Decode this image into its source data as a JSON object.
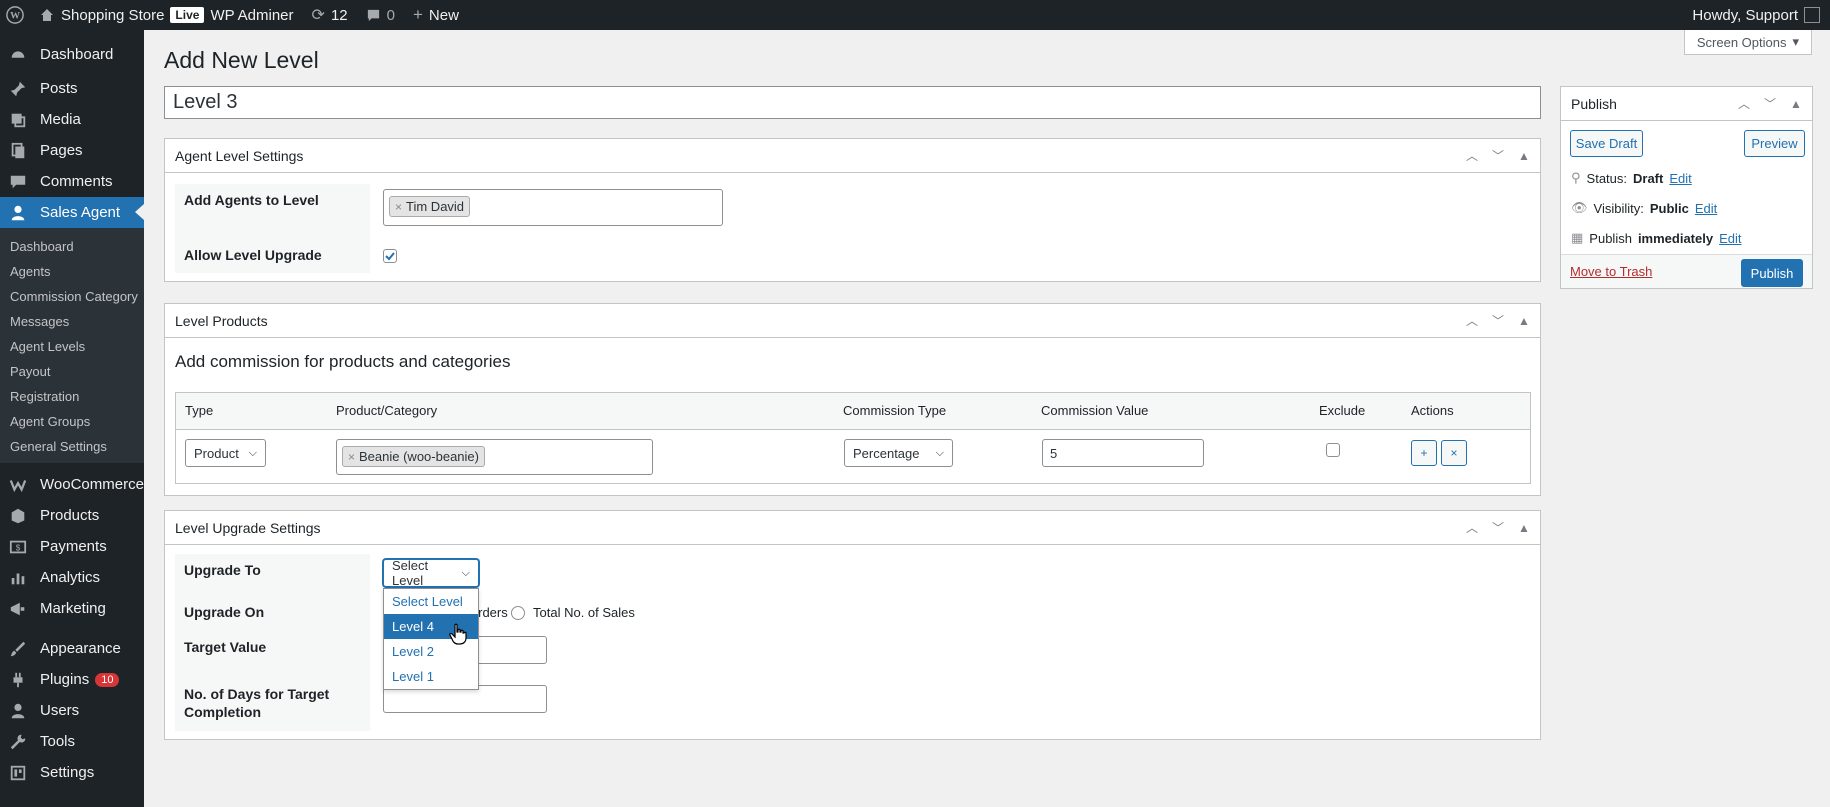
{
  "adminbar": {
    "site_name": "Shopping Store",
    "live_label": "Live",
    "admin_label": "WP Adminer",
    "updates_count": "12",
    "comments_count": "0",
    "new_label": "New",
    "howdy": "Howdy, Support"
  },
  "sidebar": {
    "items_top": [
      {
        "label": "Dashboard",
        "icon": "dashboard-icon"
      },
      {
        "label": "Posts",
        "icon": "pin-icon"
      },
      {
        "label": "Media",
        "icon": "media-icon"
      },
      {
        "label": "Pages",
        "icon": "pages-icon"
      },
      {
        "label": "Comments",
        "icon": "comment-icon"
      },
      {
        "label": "Sales Agent",
        "icon": "user-icon"
      }
    ],
    "submenu": [
      "Dashboard",
      "Agents",
      "Commission Category",
      "Messages",
      "Agent Levels",
      "Payout",
      "Registration",
      "Agent Groups",
      "General Settings"
    ],
    "items_bottom": [
      {
        "label": "WooCommerce",
        "icon": "woo-icon"
      },
      {
        "label": "Products",
        "icon": "products-icon"
      },
      {
        "label": "Payments",
        "icon": "payments-icon"
      },
      {
        "label": "Analytics",
        "icon": "analytics-icon"
      },
      {
        "label": "Marketing",
        "icon": "marketing-icon"
      },
      {
        "label": "Appearance",
        "icon": "brush-icon"
      },
      {
        "label": "Plugins",
        "icon": "plugin-icon",
        "badge": "10"
      },
      {
        "label": "Users",
        "icon": "users-icon"
      },
      {
        "label": "Tools",
        "icon": "wrench-icon"
      },
      {
        "label": "Settings",
        "icon": "settings-icon"
      }
    ]
  },
  "page": {
    "title": "Add New Level",
    "screen_options": "Screen Options",
    "level_title": "Level 3"
  },
  "agent_settings": {
    "header": "Agent Level Settings",
    "add_agents_label": "Add Agents to Level",
    "agent_tag": "Tim David",
    "allow_upgrade_label": "Allow Level Upgrade",
    "allow_upgrade_checked": true
  },
  "level_products": {
    "header": "Level Products",
    "heading": "Add commission for products and categories",
    "columns": [
      "Type",
      "Product/Category",
      "Commission Type",
      "Commission Value",
      "Exclude",
      "Actions"
    ],
    "row": {
      "type": "Product",
      "product_tag": "Beanie (woo-beanie)",
      "commission_type": "Percentage",
      "commission_value": "5",
      "add_btn": "+",
      "remove_btn": "×"
    }
  },
  "upgrade_settings": {
    "header": "Level Upgrade Settings",
    "upgrade_to_label": "Upgrade To",
    "upgrade_to_value": "Select Level",
    "upgrade_on_label": "Upgrade On",
    "option_orders": "Orders",
    "option_sales": "Total No. of Sales",
    "target_value_label": "Target Value",
    "days_label_line1": "No. of Days for Target",
    "days_label_line2": "Completion",
    "dropdown_options": [
      "Select Level",
      "Level 4",
      "Level 2",
      "Level 1"
    ],
    "highlighted_option": "Level 4"
  },
  "publish": {
    "header": "Publish",
    "save_draft": "Save Draft",
    "preview": "Preview",
    "status_label": "Status:",
    "status_value": "Draft",
    "visibility_label": "Visibility:",
    "visibility_value": "Public",
    "publish_label": "Publish",
    "publish_value": "immediately",
    "edit": "Edit",
    "trash": "Move to Trash",
    "publish_btn": "Publish"
  }
}
